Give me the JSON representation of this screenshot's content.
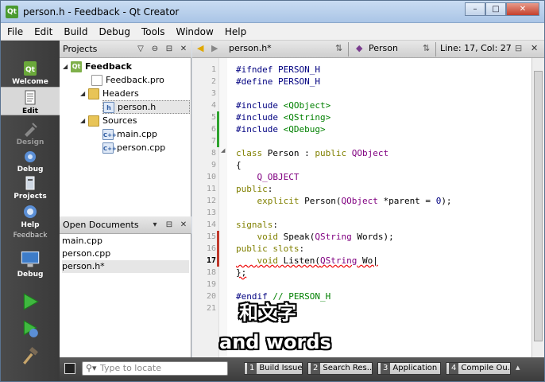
{
  "window": {
    "title": "person.h - Feedback - Qt Creator",
    "min": "–",
    "max": "□",
    "close": "✕",
    "app_icon": "Qt"
  },
  "menu": [
    "File",
    "Edit",
    "Build",
    "Debug",
    "Tools",
    "Window",
    "Help"
  ],
  "modes": [
    {
      "label": "Welcome",
      "icon": "qt-logo-icon"
    },
    {
      "label": "Edit",
      "icon": "edit-icon"
    },
    {
      "label": "Design",
      "icon": "design-icon"
    },
    {
      "label": "Debug",
      "icon": "debug-icon"
    },
    {
      "label": "Projects",
      "icon": "projects-icon"
    },
    {
      "label": "Help",
      "icon": "help-icon"
    }
  ],
  "mode_project_label": "Feedback",
  "mode_project_sublabel": "Debug",
  "projects_panel": {
    "title": "Projects",
    "tree": [
      {
        "label": "Feedback",
        "type": "proj",
        "icon_text": "Qt"
      },
      {
        "label": "Feedback.pro",
        "type": "pro",
        "icon_text": ""
      },
      {
        "label": "Headers",
        "type": "folder",
        "icon_text": ""
      },
      {
        "label": "person.h",
        "type": "h",
        "icon_text": "h"
      },
      {
        "label": "Sources",
        "type": "folder",
        "icon_text": ""
      },
      {
        "label": "main.cpp",
        "type": "cpp",
        "icon_text": "C++"
      },
      {
        "label": "person.cpp",
        "type": "cpp",
        "icon_text": "C++"
      }
    ]
  },
  "open_documents": {
    "title": "Open Documents",
    "items": [
      "main.cpp",
      "person.cpp",
      "person.h*"
    ]
  },
  "editor": {
    "file_tab": "person.h*",
    "symbol": "Person",
    "position": "Line: 17, Col: 27",
    "lines": [
      "1",
      "2",
      "3",
      "4",
      "5",
      "6",
      "7",
      "8",
      "9",
      "10",
      "11",
      "12",
      "13",
      "14",
      "15",
      "16",
      "17",
      "18",
      "19",
      "20",
      "21"
    ],
    "current_line": "17"
  },
  "subtitles": {
    "chinese": "和文字",
    "english": "and words"
  },
  "status": {
    "locate_placeholder": "Type to locate",
    "panes": [
      {
        "num": "1",
        "label": "Build Issues"
      },
      {
        "num": "2",
        "label": "Search Res..."
      },
      {
        "num": "3",
        "label": "Application ..."
      },
      {
        "num": "4",
        "label": "Compile Ou..."
      }
    ]
  }
}
